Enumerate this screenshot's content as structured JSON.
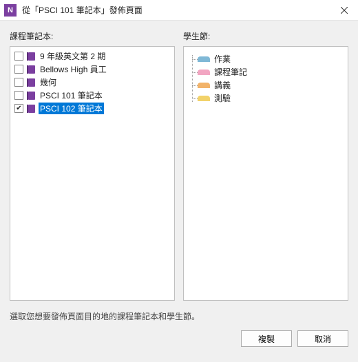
{
  "window": {
    "title": "從「PSCI 101 筆記本」發佈頁面",
    "app_icon_text": "N"
  },
  "labels": {
    "notebooks": "課程筆記本:",
    "sections": "學生節:"
  },
  "notebooks": [
    {
      "label": "9 年級英文第 2 期",
      "checked": false,
      "selected": false
    },
    {
      "label": "Bellows High 員工",
      "checked": false,
      "selected": false
    },
    {
      "label": "幾何",
      "checked": false,
      "selected": false
    },
    {
      "label": "PSCI 101 筆記本",
      "checked": false,
      "selected": false
    },
    {
      "label": "PSCI 102 筆記本",
      "checked": true,
      "selected": true
    }
  ],
  "sections": [
    {
      "label": "作業",
      "color": "#7fb8d6"
    },
    {
      "label": "課程筆記",
      "color": "#f2a6c2"
    },
    {
      "label": "講義",
      "color": "#f2b36a"
    },
    {
      "label": "測驗",
      "color": "#f2d26a"
    }
  ],
  "instruction": "選取您想要發佈頁面目的地的課程筆記本和學生節。",
  "buttons": {
    "copy": "複製",
    "cancel": "取消"
  }
}
